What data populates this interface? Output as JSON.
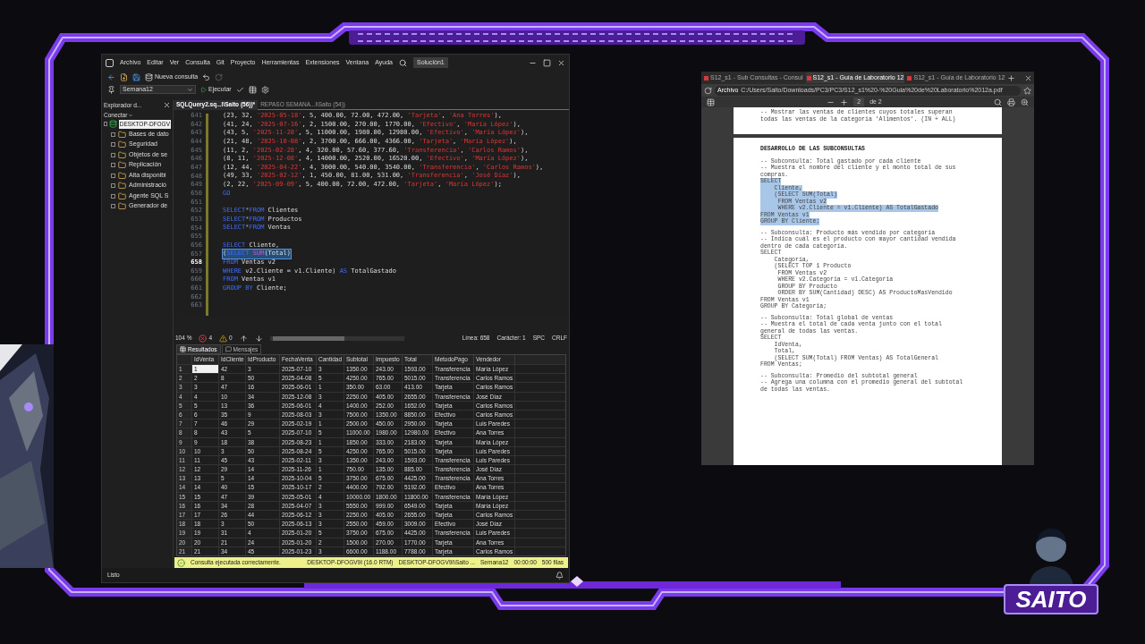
{
  "ssms": {
    "menu": [
      "Archivo",
      "Editar",
      "Ver",
      "Consulta",
      "Git",
      "Proyecto",
      "Herramientas",
      "Extensiones",
      "Ventana",
      "Ayuda"
    ],
    "solution": "Solución1",
    "new_query": "Nueva consulta",
    "database": "Semana12",
    "execute": "Ejecutar",
    "explorer": {
      "title": "Explorador d...",
      "connect": "Conectar",
      "server": "DESKTOP-DFOGV",
      "children": [
        {
          "label": "Bases de dato"
        },
        {
          "label": "Seguridad"
        },
        {
          "label": "Objetos de se"
        },
        {
          "label": "Replicación"
        },
        {
          "label": "Alta disponibi"
        },
        {
          "label": "Administració"
        },
        {
          "label": "Agente SQL S"
        },
        {
          "label": "Generador de"
        }
      ]
    },
    "doc_tabs": [
      {
        "label": "SQLQuery2.sq...l\\Saito (56))*",
        "selected": true
      },
      {
        "label": "REPASO SEMANA...l\\Saito (54))",
        "selected": false
      }
    ],
    "code": [
      {
        "n": "641",
        "current": false,
        "selected": false,
        "segs": [
          {
            "kind": "plain",
            "t": "(23, 32, "
          },
          {
            "kind": "string",
            "t": "'2025-05-18'"
          },
          {
            "kind": "plain",
            "t": ", 5, 400.00, 72.00, 472.00, "
          },
          {
            "kind": "string",
            "t": "'Tarjeta'"
          },
          {
            "kind": "plain",
            "t": ", "
          },
          {
            "kind": "string",
            "t": "'Ana Torres'"
          },
          {
            "kind": "plain",
            "t": "),"
          }
        ]
      },
      {
        "n": "642",
        "current": false,
        "selected": false,
        "segs": [
          {
            "kind": "plain",
            "t": "(41, 24, "
          },
          {
            "kind": "string",
            "t": "'2025-07-16'"
          },
          {
            "kind": "plain",
            "t": ", 2, 1500.00, 270.00, 1770.00, "
          },
          {
            "kind": "string",
            "t": "'Efectivo'"
          },
          {
            "kind": "plain",
            "t": ", "
          },
          {
            "kind": "string",
            "t": "'María López'"
          },
          {
            "kind": "plain",
            "t": "),"
          }
        ]
      },
      {
        "n": "643",
        "current": false,
        "selected": false,
        "segs": [
          {
            "kind": "plain",
            "t": "(43, 5, "
          },
          {
            "kind": "string",
            "t": "'2025-11-28'"
          },
          {
            "kind": "plain",
            "t": ", 5, 11000.00, 1980.00, 12980.00, "
          },
          {
            "kind": "string",
            "t": "'Efectivo'"
          },
          {
            "kind": "plain",
            "t": ", "
          },
          {
            "kind": "string",
            "t": "'María López'"
          },
          {
            "kind": "plain",
            "t": "),"
          }
        ]
      },
      {
        "n": "644",
        "current": false,
        "selected": false,
        "segs": [
          {
            "kind": "plain",
            "t": "(21, 48, "
          },
          {
            "kind": "string",
            "t": "'2025-10-08'"
          },
          {
            "kind": "plain",
            "t": ", 2, 3700.00, 666.00, 4366.00, "
          },
          {
            "kind": "string",
            "t": "'Tarjeta'"
          },
          {
            "kind": "plain",
            "t": ", "
          },
          {
            "kind": "string",
            "t": "'María López'"
          },
          {
            "kind": "plain",
            "t": "),"
          }
        ]
      },
      {
        "n": "645",
        "current": false,
        "selected": false,
        "segs": [
          {
            "kind": "plain",
            "t": "(11, 2, "
          },
          {
            "kind": "string",
            "t": "'2025-02-28'"
          },
          {
            "kind": "plain",
            "t": ", 4, 320.00, 57.60, 377.60, "
          },
          {
            "kind": "string",
            "t": "'Transferencia'"
          },
          {
            "kind": "plain",
            "t": ", "
          },
          {
            "kind": "string",
            "t": "'Carlos Ramos'"
          },
          {
            "kind": "plain",
            "t": "),"
          }
        ]
      },
      {
        "n": "646",
        "current": false,
        "selected": false,
        "segs": [
          {
            "kind": "plain",
            "t": "(8, 11, "
          },
          {
            "kind": "string",
            "t": "'2025-12-08'"
          },
          {
            "kind": "plain",
            "t": ", 4, 14000.00, 2520.00, 16520.00, "
          },
          {
            "kind": "string",
            "t": "'Efectivo'"
          },
          {
            "kind": "plain",
            "t": ", "
          },
          {
            "kind": "string",
            "t": "'María López'"
          },
          {
            "kind": "plain",
            "t": "),"
          }
        ]
      },
      {
        "n": "647",
        "current": false,
        "selected": false,
        "segs": [
          {
            "kind": "plain",
            "t": "(12, 44, "
          },
          {
            "kind": "string",
            "t": "'2025-04-22'"
          },
          {
            "kind": "plain",
            "t": ", 4, 3000.00, 540.00, 3540.00, "
          },
          {
            "kind": "string",
            "t": "'Transferencia'"
          },
          {
            "kind": "plain",
            "t": ", "
          },
          {
            "kind": "string",
            "t": "'Carlos Ramos'"
          },
          {
            "kind": "plain",
            "t": "),"
          }
        ]
      },
      {
        "n": "648",
        "current": false,
        "selected": false,
        "segs": [
          {
            "kind": "plain",
            "t": "(49, 33, "
          },
          {
            "kind": "string",
            "t": "'2025-02-12'"
          },
          {
            "kind": "plain",
            "t": ", 1, 450.00, 81.00, 531.00, "
          },
          {
            "kind": "string",
            "t": "'Transferencia'"
          },
          {
            "kind": "plain",
            "t": ", "
          },
          {
            "kind": "string",
            "t": "'José Díaz'"
          },
          {
            "kind": "plain",
            "t": "),"
          }
        ]
      },
      {
        "n": "649",
        "current": false,
        "selected": false,
        "segs": [
          {
            "kind": "plain",
            "t": "(2, 22, "
          },
          {
            "kind": "string",
            "t": "'2025-09-09'"
          },
          {
            "kind": "plain",
            "t": ", 5, 400.00, 72.00, 472.00, "
          },
          {
            "kind": "string",
            "t": "'Tarjeta'"
          },
          {
            "kind": "plain",
            "t": ", "
          },
          {
            "kind": "string",
            "t": "'María López'"
          },
          {
            "kind": "plain",
            "t": ");"
          }
        ]
      },
      {
        "n": "650",
        "current": false,
        "selected": false,
        "segs": [
          {
            "kind": "keyword",
            "t": "GO"
          }
        ]
      },
      {
        "n": "651",
        "current": false
      },
      {
        "n": "652",
        "current": false,
        "selected": false,
        "segs": [
          {
            "kind": "keyword",
            "t": "SELECT"
          },
          {
            "kind": "operator",
            "t": "*"
          },
          {
            "kind": "keyword",
            "t": "FROM"
          },
          {
            "kind": "plain",
            "t": " Clientes"
          }
        ]
      },
      {
        "n": "653",
        "current": false,
        "selected": false,
        "segs": [
          {
            "kind": "keyword",
            "t": "SELECT"
          },
          {
            "kind": "operator",
            "t": "*"
          },
          {
            "kind": "keyword",
            "t": "FROM"
          },
          {
            "kind": "plain",
            "t": " Productos"
          }
        ]
      },
      {
        "n": "654",
        "current": false,
        "selected": false,
        "segs": [
          {
            "kind": "keyword",
            "t": "SELECT"
          },
          {
            "kind": "operator",
            "t": "*"
          },
          {
            "kind": "keyword",
            "t": "FROM"
          },
          {
            "kind": "plain",
            "t": " Ventas"
          }
        ]
      },
      {
        "n": "655",
        "current": false
      },
      {
        "n": "656",
        "current": false,
        "selected": false,
        "segs": [
          {
            "kind": "keyword",
            "t": "SELECT"
          },
          {
            "kind": "plain",
            "t": " Cliente,"
          }
        ]
      },
      {
        "n": "657",
        "current": false,
        "selected": true,
        "segs": [
          {
            "kind": "plain",
            "t": "("
          },
          {
            "kind": "keyword",
            "t": "SELECT"
          },
          {
            "kind": "function",
            "t": " SUM"
          },
          {
            "kind": "plain",
            "t": "(Total)"
          }
        ]
      },
      {
        "n": "658",
        "current": true,
        "selected": false,
        "segs": [
          {
            "kind": "keyword",
            "t": "FROM"
          },
          {
            "kind": "plain",
            "t": " Ventas v2"
          }
        ]
      },
      {
        "n": "659",
        "current": false,
        "selected": false,
        "segs": [
          {
            "kind": "keyword",
            "t": "WHERE"
          },
          {
            "kind": "plain",
            "t": " v2.Cliente = v1.Cliente) "
          },
          {
            "kind": "keyword",
            "t": "AS"
          },
          {
            "kind": "plain",
            "t": " TotalGastado"
          }
        ]
      },
      {
        "n": "660",
        "current": false,
        "selected": false,
        "segs": [
          {
            "kind": "keyword",
            "t": "FROM"
          },
          {
            "kind": "plain",
            "t": " Ventas v1"
          }
        ]
      },
      {
        "n": "661",
        "current": false,
        "selected": false,
        "segs": [
          {
            "kind": "keyword",
            "t": "GROUP BY"
          },
          {
            "kind": "plain",
            "t": " Cliente;"
          }
        ]
      },
      {
        "n": "662",
        "current": false
      },
      {
        "n": "663",
        "current": false
      }
    ],
    "editor_status": {
      "zoom": "104 %",
      "errors": "4",
      "warnings": "0",
      "line": "Línea: 658",
      "char": "Carácter: 1",
      "spc": "SPC",
      "crlf": "CRLF"
    },
    "result_tabs": [
      {
        "label": "Resultados",
        "selected": true
      },
      {
        "label": "Mensajes",
        "selected": false
      }
    ],
    "columns": [
      "IdVenta",
      "IdCliente",
      "IdProducto",
      "FechaVenta",
      "Cantidad",
      "Subtotal",
      "Impuesto",
      "Total",
      "MetodoPago",
      "Vendedor"
    ],
    "rows": [
      {
        "n": "1",
        "selected": true,
        "cells": [
          "1",
          "42",
          "3",
          "2025-07-10",
          "3",
          "1350.00",
          "243.00",
          "1593.00",
          "Transferencia",
          "María López"
        ]
      },
      {
        "n": "2",
        "selected": false,
        "cells": [
          "2",
          "8",
          "50",
          "2025-04-08",
          "5",
          "4250.00",
          "765.00",
          "5015.00",
          "Transferencia",
          "Carlos Ramos"
        ]
      },
      {
        "n": "3",
        "selected": false,
        "cells": [
          "3",
          "47",
          "16",
          "2025-06-01",
          "1",
          "350.00",
          "63.00",
          "413.00",
          "Tarjeta",
          "Carlos Ramos"
        ]
      },
      {
        "n": "4",
        "selected": false,
        "cells": [
          "4",
          "10",
          "34",
          "2025-12-08",
          "3",
          "2250.00",
          "405.00",
          "2655.00",
          "Transferencia",
          "José Díaz"
        ]
      },
      {
        "n": "5",
        "selected": false,
        "cells": [
          "5",
          "13",
          "36",
          "2025-06-01",
          "4",
          "1400.00",
          "252.00",
          "1652.00",
          "Tarjeta",
          "Carlos Ramos"
        ]
      },
      {
        "n": "6",
        "selected": false,
        "cells": [
          "6",
          "35",
          "9",
          "2025-08-03",
          "3",
          "7500.00",
          "1350.00",
          "8850.00",
          "Efectivo",
          "Carlos Ramos"
        ]
      },
      {
        "n": "7",
        "selected": false,
        "cells": [
          "7",
          "46",
          "29",
          "2025-02-19",
          "1",
          "2500.00",
          "450.00",
          "2950.00",
          "Tarjeta",
          "Luis Paredes"
        ]
      },
      {
        "n": "8",
        "selected": false,
        "cells": [
          "8",
          "43",
          "5",
          "2025-07-10",
          "5",
          "11000.00",
          "1980.00",
          "12980.00",
          "Efectivo",
          "Ana Torres"
        ]
      },
      {
        "n": "9",
        "selected": false,
        "cells": [
          "9",
          "18",
          "38",
          "2025-08-23",
          "1",
          "1850.00",
          "333.00",
          "2183.00",
          "Tarjeta",
          "María López"
        ]
      },
      {
        "n": "10",
        "selected": false,
        "cells": [
          "10",
          "3",
          "50",
          "2025-08-24",
          "5",
          "4250.00",
          "765.00",
          "5015.00",
          "Tarjeta",
          "Luis Paredes"
        ]
      },
      {
        "n": "11",
        "selected": false,
        "cells": [
          "11",
          "45",
          "43",
          "2025-02-11",
          "3",
          "1350.00",
          "243.00",
          "1593.00",
          "Transferencia",
          "Luis Paredes"
        ]
      },
      {
        "n": "12",
        "selected": false,
        "cells": [
          "12",
          "29",
          "14",
          "2025-11-26",
          "1",
          "750.00",
          "135.00",
          "885.00",
          "Transferencia",
          "José Díaz"
        ]
      },
      {
        "n": "13",
        "selected": false,
        "cells": [
          "13",
          "5",
          "14",
          "2025-10-04",
          "5",
          "3750.00",
          "675.00",
          "4425.00",
          "Transferencia",
          "Ana Torres"
        ]
      },
      {
        "n": "14",
        "selected": false,
        "cells": [
          "14",
          "40",
          "15",
          "2025-10-17",
          "2",
          "4400.00",
          "792.00",
          "5192.00",
          "Efectivo",
          "Ana Torres"
        ]
      },
      {
        "n": "15",
        "selected": false,
        "cells": [
          "15",
          "47",
          "39",
          "2025-05-01",
          "4",
          "10000.00",
          "1800.00",
          "11800.00",
          "Transferencia",
          "María López"
        ]
      },
      {
        "n": "16",
        "selected": false,
        "cells": [
          "16",
          "34",
          "28",
          "2025-04-07",
          "3",
          "5550.00",
          "999.00",
          "6549.00",
          "Tarjeta",
          "María López"
        ]
      },
      {
        "n": "17",
        "selected": false,
        "cells": [
          "17",
          "26",
          "44",
          "2025-06-12",
          "3",
          "2250.00",
          "405.00",
          "2655.00",
          "Tarjeta",
          "Carlos Ramos"
        ]
      },
      {
        "n": "18",
        "selected": false,
        "cells": [
          "18",
          "3",
          "50",
          "2025-06-13",
          "3",
          "2550.00",
          "459.00",
          "3009.00",
          "Efectivo",
          "José Díaz"
        ]
      },
      {
        "n": "19",
        "selected": false,
        "cells": [
          "19",
          "31",
          "4",
          "2025-01-20",
          "5",
          "3750.00",
          "675.00",
          "4425.00",
          "Transferencia",
          "Luis Paredes"
        ]
      },
      {
        "n": "20",
        "selected": false,
        "cells": [
          "20",
          "21",
          "24",
          "2025-01-20",
          "2",
          "1500.00",
          "270.00",
          "1770.00",
          "Tarjeta",
          "Ana Torres"
        ]
      },
      {
        "n": "21",
        "selected": false,
        "cells": [
          "21",
          "34",
          "45",
          "2025-01-23",
          "3",
          "6600.00",
          "1188.00",
          "7788.00",
          "Tarjeta",
          "Carlos Ramos"
        ]
      }
    ],
    "query_status": {
      "message": "Consulta ejecutada correctamente.",
      "server": "DESKTOP-DFOGV9I (16.0 RTM)",
      "user": "DESKTOP-DFOGV9I\\Saito ...",
      "db": "Semana12",
      "time": "00:00:00",
      "rows": "500 filas"
    },
    "ready": "Listo"
  },
  "browser": {
    "tabs": [
      {
        "label": "S12_s1 - Sub Consultas - Consul",
        "selected": false
      },
      {
        "label": "S12_s1 - Guía de Laboratorio 12",
        "selected": true
      },
      {
        "label": "S12_s1 - Guía de Laboratorio 12",
        "selected": false
      }
    ],
    "address_label": "Archivo",
    "address": "C:/Users/Saito/Downloads/PC3/PC3/S12_s1%20-%20Guia%20de%20Laboratorio%2012a.pdf",
    "page": "2",
    "page_total": "de 2",
    "page1_lines": [
      "-- Mostrar las ventas de clientes cuyos totales superan",
      "todas las ventas de la categoría 'Alimentos'. (IN + ALL)"
    ],
    "page2_title": "DESARROLLO DE LAS SUBCONSULTAS",
    "blocks": [
      [
        {
          "t": "-- Subconsulta: Total gastado por cada cliente",
          "highlighted": false
        },
        {
          "t": "-- Muestra el nombre del cliente y el monto total de sus",
          "highlighted": false
        },
        {
          "t": "compras.",
          "highlighted": false
        },
        {
          "t": "SELECT",
          "highlighted": true
        },
        {
          "t": "    Cliente,",
          "highlighted": true
        },
        {
          "t": "    (SELECT SUM(Total)",
          "highlighted": true
        },
        {
          "t": "     FROM Ventas v2",
          "highlighted": true
        },
        {
          "t": "     WHERE v2.Cliente = v1.Cliente) AS TotalGastado",
          "highlighted": true
        },
        {
          "t": "FROM Ventas v1",
          "highlighted": true
        },
        {
          "t": "GROUP BY Cliente;",
          "highlighted": true
        }
      ],
      [
        {
          "t": "-- Subconsulta: Producto más vendido por categoría",
          "highlighted": false
        },
        {
          "t": "-- Indica cuál es el producto con mayor cantidad vendida",
          "highlighted": false
        },
        {
          "t": "dentro de cada categoría.",
          "highlighted": false
        },
        {
          "t": "SELECT",
          "highlighted": false
        },
        {
          "t": "    Categoria,",
          "highlighted": false
        },
        {
          "t": "    (SELECT TOP 1 Producto",
          "highlighted": false
        },
        {
          "t": "     FROM Ventas v2",
          "highlighted": false
        },
        {
          "t": "     WHERE v2.Categoria = v1.Categoria",
          "highlighted": false
        },
        {
          "t": "     GROUP BY Producto",
          "highlighted": false
        },
        {
          "t": "     ORDER BY SUM(Cantidad) DESC) AS ProductoMasVendido",
          "highlighted": false
        },
        {
          "t": "FROM Ventas v1",
          "highlighted": false
        },
        {
          "t": "GROUP BY Categoria;",
          "highlighted": false
        }
      ],
      [
        {
          "t": "-- Subconsulta: Total global de ventas",
          "highlighted": false
        },
        {
          "t": "-- Muestra el total de cada venta junto con el total",
          "highlighted": false
        },
        {
          "t": "general de todas las ventas.",
          "highlighted": false
        },
        {
          "t": "SELECT",
          "highlighted": false
        },
        {
          "t": "    IdVenta,",
          "highlighted": false
        },
        {
          "t": "    Total,",
          "highlighted": false
        },
        {
          "t": "    (SELECT SUM(Total) FROM Ventas) AS TotalGeneral",
          "highlighted": false
        },
        {
          "t": "FROM Ventas;",
          "highlighted": false
        }
      ],
      [
        {
          "t": "-- Subconsulta: Promedio del subtotal general",
          "highlighted": false
        },
        {
          "t": "-- Agrega una columna con el promedio general del subtotal",
          "highlighted": false
        },
        {
          "t": "de todas las ventas.",
          "highlighted": false
        }
      ]
    ]
  },
  "streamer": {
    "name": "SAITO"
  }
}
